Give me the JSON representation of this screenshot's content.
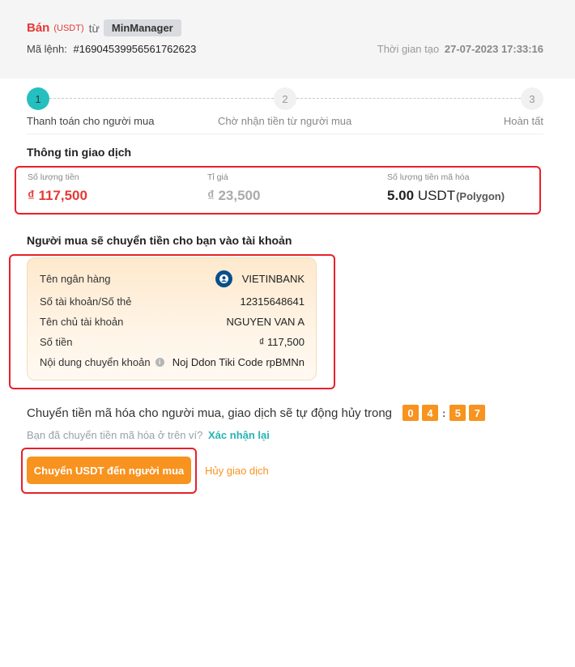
{
  "header": {
    "sell_label": "Bán",
    "coin_label": "(USDT)",
    "from_label": "từ",
    "manager_name": "MinManager",
    "order_label": "Mã lệnh:",
    "order_id": "#16904539956561762623",
    "created_label": "Thời gian tạo",
    "created_time": "27-07-2023 17:33:16"
  },
  "steps": [
    {
      "number": "1",
      "label": "Thanh toán cho người mua",
      "active": true
    },
    {
      "number": "2",
      "label": "Chờ nhận tiền từ người mua",
      "active": false
    },
    {
      "number": "3",
      "label": "Hoàn tất",
      "active": false
    }
  ],
  "transaction": {
    "section_title": "Thông tin giao dịch",
    "amount_label": "Số lượng tiền",
    "amount_value": "₫ 117,500",
    "rate_label": "Tỉ giá",
    "rate_value": "₫ 23,500",
    "crypto_label": "Số lượng tiền mã hóa",
    "crypto_amount": "5.00",
    "crypto_unit": " USDT",
    "crypto_network": "(Polygon)"
  },
  "bank": {
    "section_title": "Người mua sẽ chuyển tiền cho bạn vào tài khoản",
    "rows": [
      {
        "label": "Tên ngân hàng",
        "value": "VIETINBANK"
      },
      {
        "label": "Số tài khoản/Số thẻ",
        "value": "12315648641"
      },
      {
        "label": "Tên chủ tài khoản",
        "value": "NGUYEN VAN A"
      },
      {
        "label": "Số tiền",
        "value": "₫ 117,500"
      },
      {
        "label": "Nội dung chuyển khoản",
        "value": "Noj Ddon Tiki Code rpBMNn"
      }
    ],
    "bank_logo_icon": "vietinbank-logo-icon",
    "info_icon": "info-icon"
  },
  "countdown": {
    "text": "Chuyển tiền mã hóa cho người mua, giao dịch sẽ tự động hủy trong",
    "digits": [
      "0",
      "4",
      "5",
      "7"
    ],
    "separator": ":"
  },
  "confirm": {
    "question": "Bạn đã chuyển tiền mã hóa ở trên ví?",
    "link": "Xác nhận lại"
  },
  "actions": {
    "primary": "Chuyển USDT đến người mua",
    "cancel": "Hủy giao dịch"
  },
  "colors": {
    "accent_orange": "#f7931e",
    "accent_teal": "#26bfbf",
    "sell_red": "#e53935",
    "highlight_red": "#e8202a"
  }
}
